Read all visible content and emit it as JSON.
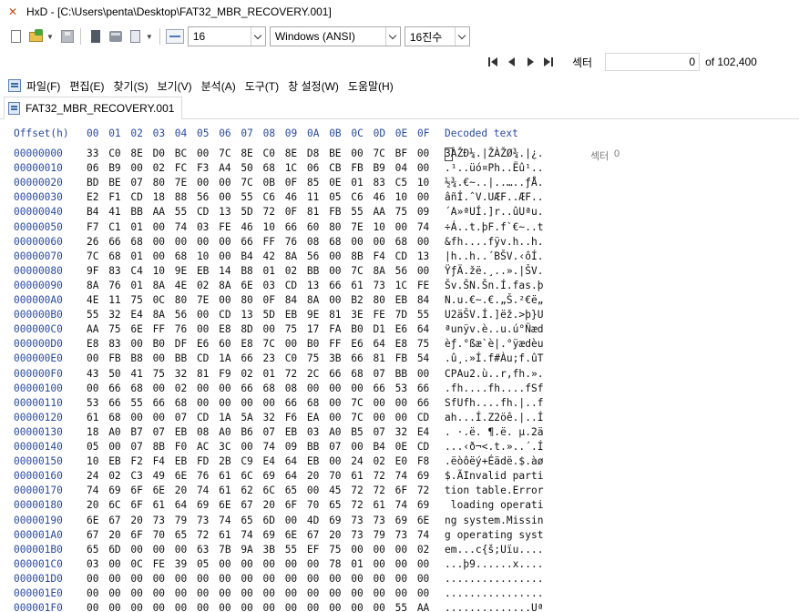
{
  "titlebar": {
    "title": "HxD - [C:\\Users\\penta\\Desktop\\FAT32_MBR_RECOVERY.001]"
  },
  "toolbar": {
    "bytes_per_row": "16",
    "charset": "Windows (ANSI)",
    "offset_base": "16진수"
  },
  "navigation": {
    "label": "섹터",
    "current_sector": "0",
    "total_sectors": "of 102,400"
  },
  "menu": {
    "items": [
      "파일(F)",
      "편집(E)",
      "찾기(S)",
      "보기(V)",
      "분석(A)",
      "도구(T)",
      "창 설정(W)",
      "도움말(H)"
    ]
  },
  "tab": {
    "label": "FAT32_MBR_RECOVERY.001"
  },
  "hex": {
    "offset_header": "Offset(h)",
    "columns": [
      "00",
      "01",
      "02",
      "03",
      "04",
      "05",
      "06",
      "07",
      "08",
      "09",
      "0A",
      "0B",
      "0C",
      "0D",
      "0E",
      "0F"
    ],
    "decoded_header": "Decoded text",
    "sector_label": "섹터",
    "sector_value": "0",
    "rows": [
      {
        "offset": "00000000",
        "bytes": "33 C0 8E D0 BC 00 7C 8E C0 8E D8 BE 00 7C BF 00",
        "text": "3ÀŽÐ¼.|ŽÀŽØ¾.|¿."
      },
      {
        "offset": "00000010",
        "bytes": "06 B9 00 02 FC F3 A4 50 68 1C 06 CB FB B9 04 00",
        "text": ".¹..üó¤Ph..Ëû¹.."
      },
      {
        "offset": "00000020",
        "bytes": "BD BE 07 80 7E 00 00 7C 0B 0F 85 0E 01 83 C5 10",
        "text": "½¾.€~..|..…..ƒÅ."
      },
      {
        "offset": "00000030",
        "bytes": "E2 F1 CD 18 88 56 00 55 C6 46 11 05 C6 46 10 00",
        "text": "âñÍ.ˆV.UÆF..ÆF.."
      },
      {
        "offset": "00000040",
        "bytes": "B4 41 BB AA 55 CD 13 5D 72 0F 81 FB 55 AA 75 09",
        "text": "´A»ªUÍ.]r..ûUªu."
      },
      {
        "offset": "00000050",
        "bytes": "F7 C1 01 00 74 03 FE 46 10 66 60 80 7E 10 00 74",
        "text": "÷Á..t.þF.f`€~..t"
      },
      {
        "offset": "00000060",
        "bytes": "26 66 68 00 00 00 00 66 FF 76 08 68 00 00 68 00",
        "text": "&fh....fÿv.h..h."
      },
      {
        "offset": "00000070",
        "bytes": "7C 68 01 00 68 10 00 B4 42 8A 56 00 8B F4 CD 13",
        "text": "|h..h..´BŠV.‹ôÍ."
      },
      {
        "offset": "00000080",
        "bytes": "9F 83 C4 10 9E EB 14 B8 01 02 BB 00 7C 8A 56 00",
        "text": "ŸƒÄ.žë.¸..».|ŠV."
      },
      {
        "offset": "00000090",
        "bytes": "8A 76 01 8A 4E 02 8A 6E 03 CD 13 66 61 73 1C FE",
        "text": "Šv.ŠN.Šn.Í.fas.þ"
      },
      {
        "offset": "000000A0",
        "bytes": "4E 11 75 0C 80 7E 00 80 0F 84 8A 00 B2 80 EB 84",
        "text": "N.u.€~.€.„Š.²€ë„"
      },
      {
        "offset": "000000B0",
        "bytes": "55 32 E4 8A 56 00 CD 13 5D EB 9E 81 3E FE 7D 55",
        "text": "U2äŠV.Í.]ëž.>þ}U"
      },
      {
        "offset": "000000C0",
        "bytes": "AA 75 6E FF 76 00 E8 8D 00 75 17 FA B0 D1 E6 64",
        "text": "ªunÿv.è..u.ú°Ñæd"
      },
      {
        "offset": "000000D0",
        "bytes": "E8 83 00 B0 DF E6 60 E8 7C 00 B0 FF E6 64 E8 75",
        "text": "èƒ.°ßæ`è|.°ÿædèu"
      },
      {
        "offset": "000000E0",
        "bytes": "00 FB B8 00 BB CD 1A 66 23 C0 75 3B 66 81 FB 54",
        "text": ".û¸.»Í.f#Àu;f.ûT"
      },
      {
        "offset": "000000F0",
        "bytes": "43 50 41 75 32 81 F9 02 01 72 2C 66 68 07 BB 00",
        "text": "CPAu2.ù..r,fh.»."
      },
      {
        "offset": "00000100",
        "bytes": "00 66 68 00 02 00 00 66 68 08 00 00 00 66 53 66",
        "text": ".fh....fh....fSf"
      },
      {
        "offset": "00000110",
        "bytes": "53 66 55 66 68 00 00 00 00 66 68 00 7C 00 00 66",
        "text": "SfUfh....fh.|..f"
      },
      {
        "offset": "00000120",
        "bytes": "61 68 00 00 07 CD 1A 5A 32 F6 EA 00 7C 00 00 CD",
        "text": "ah...Í.Z2öê.|..Í"
      },
      {
        "offset": "00000130",
        "bytes": "18 A0 B7 07 EB 08 A0 B6 07 EB 03 A0 B5 07 32 E4",
        "text": ". ·.ë. ¶.ë. µ.2ä"
      },
      {
        "offset": "00000140",
        "bytes": "05 00 07 8B F0 AC 3C 00 74 09 BB 07 00 B4 0E CD",
        "text": "...‹ð¬<.t.»..´.Í"
      },
      {
        "offset": "00000150",
        "bytes": "10 EB F2 F4 EB FD 2B C9 E4 64 EB 00 24 02 E0 F8",
        "text": ".ëòôëý+Éädë.$.àø"
      },
      {
        "offset": "00000160",
        "bytes": "24 02 C3 49 6E 76 61 6C 69 64 20 70 61 72 74 69",
        "text": "$.ÃInvalid parti"
      },
      {
        "offset": "00000170",
        "bytes": "74 69 6F 6E 20 74 61 62 6C 65 00 45 72 72 6F 72",
        "text": "tion table.Error"
      },
      {
        "offset": "00000180",
        "bytes": "20 6C 6F 61 64 69 6E 67 20 6F 70 65 72 61 74 69",
        "text": " loading operati"
      },
      {
        "offset": "00000190",
        "bytes": "6E 67 20 73 79 73 74 65 6D 00 4D 69 73 73 69 6E",
        "text": "ng system.Missin"
      },
      {
        "offset": "000001A0",
        "bytes": "67 20 6F 70 65 72 61 74 69 6E 67 20 73 79 73 74",
        "text": "g operating syst"
      },
      {
        "offset": "000001B0",
        "bytes": "65 6D 00 00 00 63 7B 9A 3B 55 EF 75 00 00 00 02",
        "text": "em...c{š;Uïu...."
      },
      {
        "offset": "000001C0",
        "bytes": "03 00 0C FE 39 05 00 00 00 00 00 78 01 00 00 00",
        "text": "...þ9......x...."
      },
      {
        "offset": "000001D0",
        "bytes": "00 00 00 00 00 00 00 00 00 00 00 00 00 00 00 00",
        "text": "................"
      },
      {
        "offset": "000001E0",
        "bytes": "00 00 00 00 00 00 00 00 00 00 00 00 00 00 00 00",
        "text": "................"
      },
      {
        "offset": "000001F0",
        "bytes": "00 00 00 00 00 00 00 00 00 00 00 00 00 00 55 AA",
        "text": "..............Uª"
      }
    ]
  }
}
